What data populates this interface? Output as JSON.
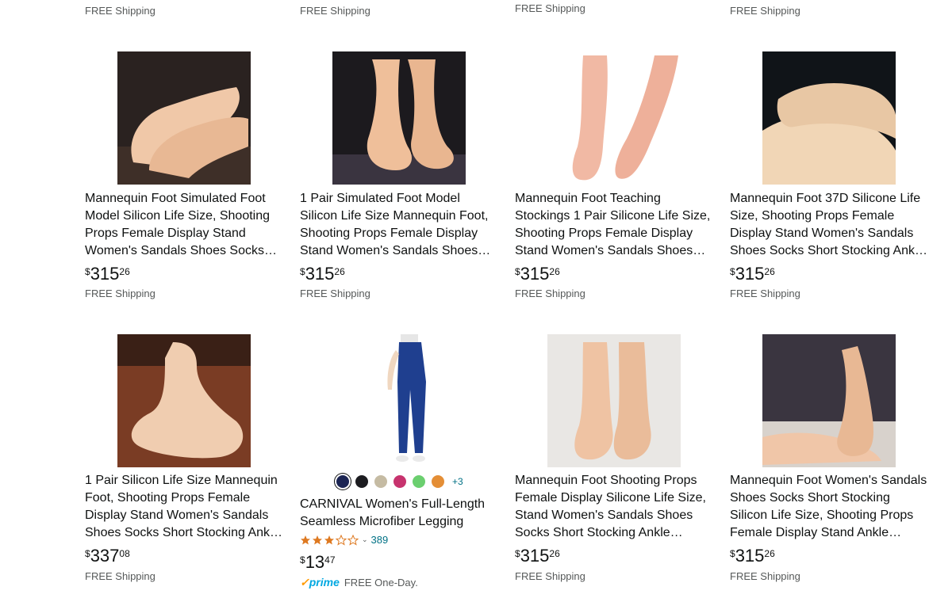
{
  "top_row": {
    "shipping": [
      "FREE Shipping",
      "FREE Shipping",
      "FREE Shipping",
      "FREE Shipping"
    ]
  },
  "products": [
    {
      "title": "Mannequin Foot Simulated Foot Model Silicon Life Size, Shooting Props Female Display Stand Women's Sandals Shoes Socks Short Stocking Ankle Chains",
      "price_symbol": "$",
      "price_whole": "315",
      "price_fraction": "26",
      "shipping": "FREE Shipping",
      "image": "foot-photo"
    },
    {
      "title": "1 Pair Simulated Foot Model Silicon Life Size Mannequin Foot, Shooting Props Female Display Stand Women's Sandals Shoes Socks Short Stocking Ankle Chains",
      "price_symbol": "$",
      "price_whole": "315",
      "price_fraction": "26",
      "shipping": "FREE Shipping",
      "image": "foot-photo"
    },
    {
      "title": "Mannequin Foot Teaching Stockings 1 Pair Silicone Life Size, Shooting Props Female Display Stand Women's Sandals Shoes Socks Short Stocking Ankle Chains",
      "price_symbol": "$",
      "price_whole": "315",
      "price_fraction": "26",
      "shipping": "FREE Shipping",
      "image": "foot-photo"
    },
    {
      "title": "Mannequin Foot 37D Silicone Life Size, Shooting Props Female Display Stand Women's Sandals Shoes Socks Short Stocking Ankle Chains, Art Teaching",
      "price_symbol": "$",
      "price_whole": "315",
      "price_fraction": "26",
      "shipping": "FREE Shipping",
      "image": "foot-photo"
    },
    {
      "title": "1 Pair Silicon Life Size Mannequin Foot, Shooting Props Female Display Stand Women's Sandals Shoes Socks Short Stocking Ankle Chains, Art Teaching",
      "price_symbol": "$",
      "price_whole": "337",
      "price_fraction": "08",
      "shipping": "FREE Shipping",
      "image": "foot-photo"
    },
    {
      "title": "CARNIVAL Women's Full-Length Seamless Microfiber Legging",
      "price_symbol": "$",
      "price_whole": "13",
      "price_fraction": "47",
      "rating_count": "389",
      "more_colors": "+3",
      "prime_shipping": "FREE One-Day.",
      "prime_label": "prime",
      "image": "legging-photo",
      "swatch_colors": [
        "#1b2453",
        "#1c1c20",
        "#c5bba3",
        "#c7336e",
        "#6bcf6f",
        "#e48e36"
      ]
    },
    {
      "title": "Mannequin Foot Shooting Props Female Display Silicone Life Size, Stand Women's Sandals Shoes Socks Short Stocking Ankle Chains, Art Teaching",
      "price_symbol": "$",
      "price_whole": "315",
      "price_fraction": "26",
      "shipping": "FREE Shipping",
      "image": "foot-photo"
    },
    {
      "title": "Mannequin Foot Women's Sandals Shoes Socks Short Stocking Silicon Life Size, Shooting Props Female Display Stand Ankle Chains, Art Teaching",
      "price_symbol": "$",
      "price_whole": "315",
      "price_fraction": "26",
      "shipping": "FREE Shipping",
      "image": "foot-photo"
    }
  ],
  "colors": {
    "link": "#007185",
    "muted": "#565959",
    "star": "#de7921",
    "prime": "#00a8e1"
  }
}
